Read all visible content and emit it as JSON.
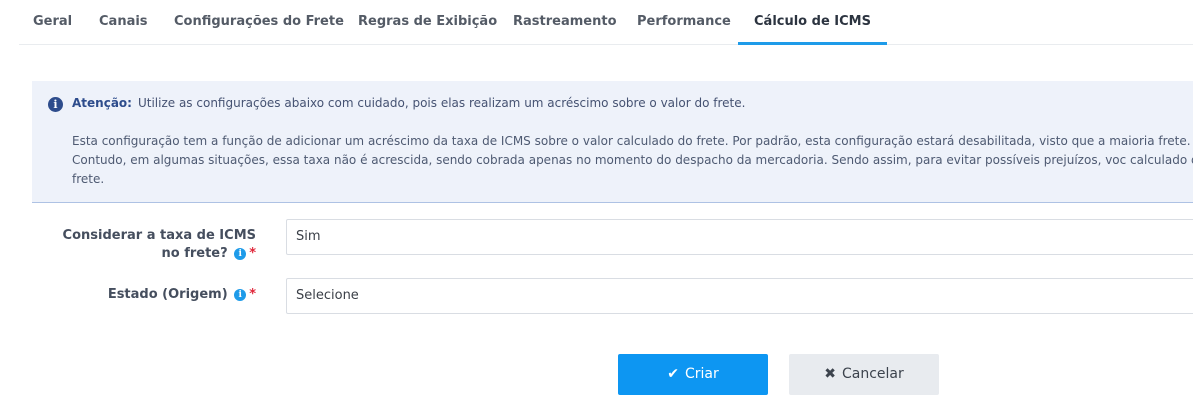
{
  "tabs": [
    {
      "label": "Geral",
      "active": false
    },
    {
      "label": "Canais",
      "active": false
    },
    {
      "label": "Configurações do Frete",
      "active": false
    },
    {
      "label": "Regras de Exibição",
      "active": false
    },
    {
      "label": "Rastreamento",
      "active": false
    },
    {
      "label": "Performance",
      "active": false
    },
    {
      "label": "Cálculo de ICMS",
      "active": true
    }
  ],
  "alert": {
    "icon": "info-icon",
    "title": "Atenção:",
    "intro": "Utilize as configurações abaixo com cuidado, pois elas realizam um acréscimo sobre o valor do frete.",
    "body": "Esta configuração tem a função de adicionar um acréscimo da taxa de ICMS sobre o valor calculado do frete. Por padrão, esta configuração estará desabilitada, visto que a maioria frete. Contudo, em algumas situações, essa taxa não é acrescida, sendo cobrada apenas no momento do despacho da mercadoria. Sendo assim, para evitar possíveis prejuízos, voc calculado do frete."
  },
  "form": {
    "icms": {
      "label": "Considerar a taxa de ICMS no frete?",
      "value": "Sim",
      "required": "*"
    },
    "estado": {
      "label": "Estado (Origem)",
      "value": "Selecione",
      "required": "*"
    }
  },
  "buttons": {
    "create_label": "Criar",
    "cancel_label": "Cancelar"
  },
  "colors": {
    "primary": "#0d96f2",
    "tab_active_underline": "#1e9be9",
    "alert_bg": "#eef2fa",
    "required": "#e0263a"
  }
}
